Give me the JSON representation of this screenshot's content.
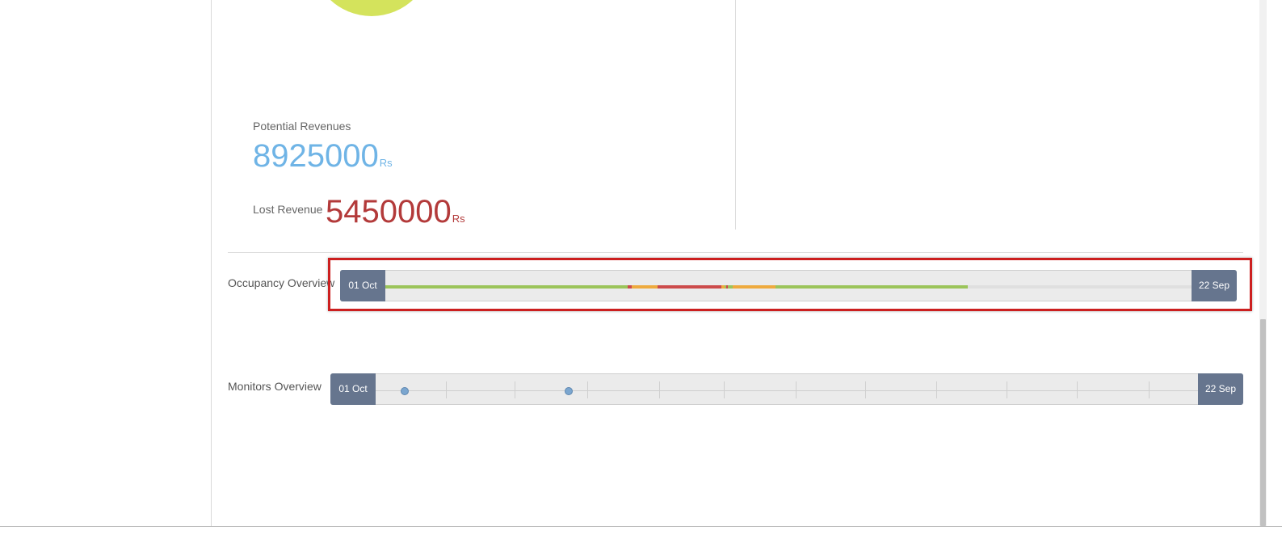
{
  "revenue": {
    "potential_label": "Potential Revenues",
    "potential_value": "8925000",
    "potential_unit": "Rs",
    "lost_label": "Lost Revenue",
    "lost_value": "5450000",
    "lost_unit": "Rs"
  },
  "occupancy": {
    "label": "Occupancy Overview",
    "start": "01 Oct",
    "end": "22 Sep",
    "segments": [
      {
        "from": 0.0,
        "to": 0.301,
        "status": "green"
      },
      {
        "from": 0.301,
        "to": 0.306,
        "status": "red"
      },
      {
        "from": 0.306,
        "to": 0.338,
        "status": "orange"
      },
      {
        "from": 0.338,
        "to": 0.417,
        "status": "red"
      },
      {
        "from": 0.417,
        "to": 0.421,
        "status": "orange"
      },
      {
        "from": 0.421,
        "to": 0.423,
        "status": "green"
      },
      {
        "from": 0.423,
        "to": 0.425,
        "status": "red"
      },
      {
        "from": 0.425,
        "to": 0.431,
        "status": "green"
      },
      {
        "from": 0.431,
        "to": 0.484,
        "status": "orange"
      },
      {
        "from": 0.484,
        "to": 0.722,
        "status": "green"
      }
    ],
    "colors": {
      "green": "#9bc45a",
      "red": "#cc4b4b",
      "orange": "#eeaa3e"
    }
  },
  "monitors": {
    "label": "Monitors Overview",
    "start": "01 Oct",
    "end": "22 Sep",
    "tick_fractions": [
      0.085,
      0.169,
      0.257,
      0.345,
      0.423,
      0.511,
      0.595,
      0.682,
      0.767,
      0.853,
      0.94
    ],
    "marker_fractions": [
      0.035,
      0.235
    ]
  }
}
